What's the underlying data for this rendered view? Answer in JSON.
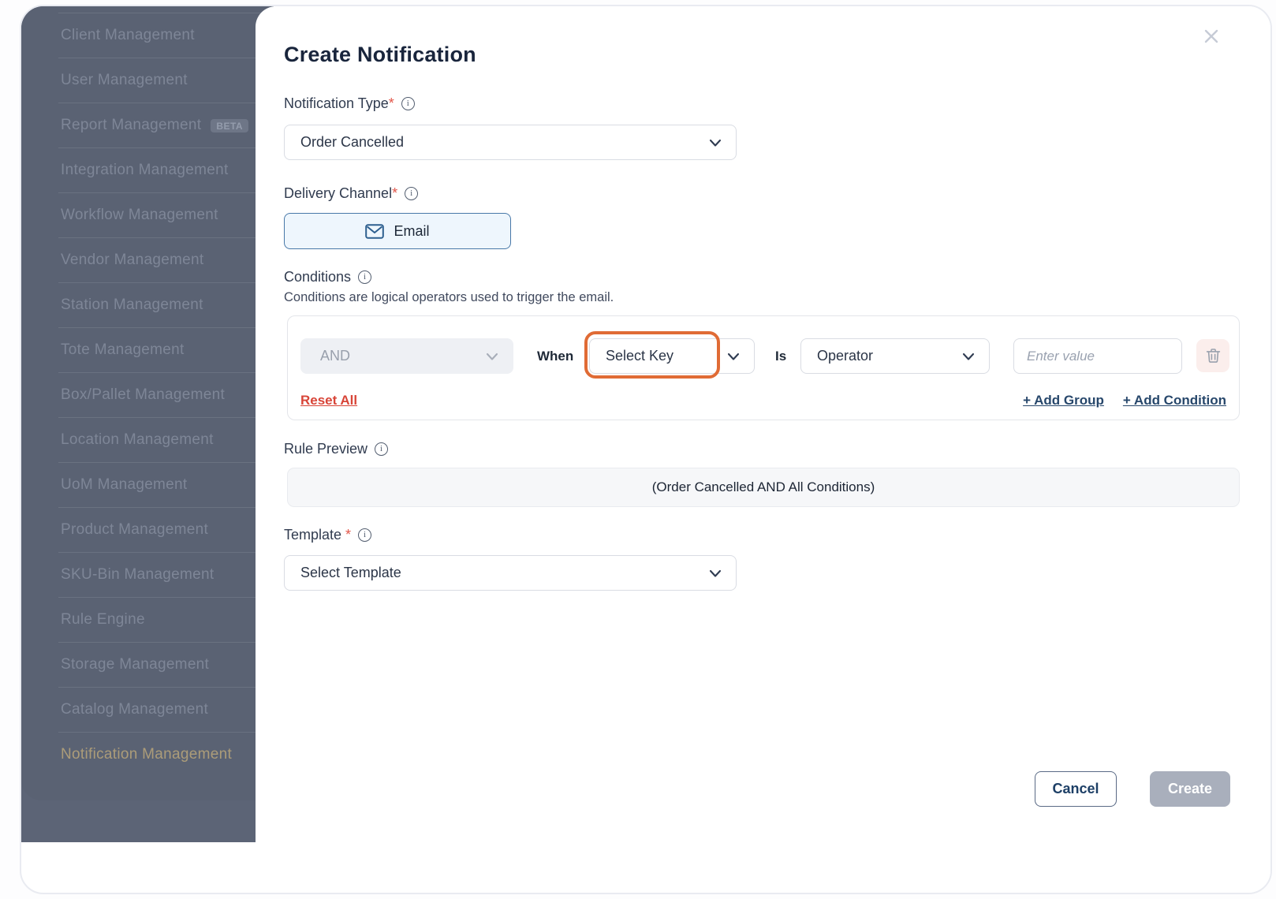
{
  "icons": {
    "info": "i"
  },
  "colors": {
    "sidebar_bg": "#5c6476",
    "sidebar_text": "#7e8697",
    "sidebar_active_text": "#ac9c79",
    "required_red": "#e25649",
    "highlight_ring_orange": "#e06b35",
    "email_chip_bg": "#eef6fd",
    "email_chip_border": "#4878a8",
    "reset_link_red": "#d84538",
    "add_link_navy": "#27476b",
    "create_disabled_bg": "#a9afbc"
  },
  "sidebar": {
    "items": [
      {
        "label": "Client Management"
      },
      {
        "label": "User Management"
      },
      {
        "label": "Report Management",
        "badge": "BETA"
      },
      {
        "label": "Integration Management"
      },
      {
        "label": "Workflow Management"
      },
      {
        "label": "Vendor Management"
      },
      {
        "label": "Station Management"
      },
      {
        "label": "Tote Management"
      },
      {
        "label": "Box/Pallet Management"
      },
      {
        "label": "Location Management"
      },
      {
        "label": "UoM Management"
      },
      {
        "label": "Product Management"
      },
      {
        "label": "SKU-Bin Management"
      },
      {
        "label": "Rule Engine"
      },
      {
        "label": "Storage Management"
      },
      {
        "label": "Catalog Management"
      },
      {
        "label": "Notification Management",
        "active": true
      }
    ]
  },
  "modal": {
    "title": "Create Notification",
    "notification_type": {
      "label": "Notification Type",
      "required_mark": "*",
      "value": "Order Cancelled"
    },
    "delivery_channel": {
      "label": "Delivery Channel",
      "required_mark": "*",
      "options": [
        {
          "label": "Email",
          "selected": true
        }
      ]
    },
    "conditions": {
      "label": "Conditions",
      "description": "Conditions are logical operators used to trigger the email.",
      "row": {
        "logic_operator": "AND",
        "when_label": "When",
        "key_placeholder": "Select Key",
        "is_label": "Is",
        "operator_placeholder": "Operator",
        "value_placeholder": "Enter value"
      },
      "reset_label": "Reset All",
      "add_group_label": "+ Add Group",
      "add_condition_label": "+ Add Condition"
    },
    "rule_preview": {
      "label": "Rule Preview",
      "value": "(Order Cancelled AND All Conditions)"
    },
    "template": {
      "label": "Template",
      "required_mark": "*",
      "placeholder": "Select Template"
    },
    "footer": {
      "cancel_label": "Cancel",
      "create_label": "Create"
    }
  }
}
